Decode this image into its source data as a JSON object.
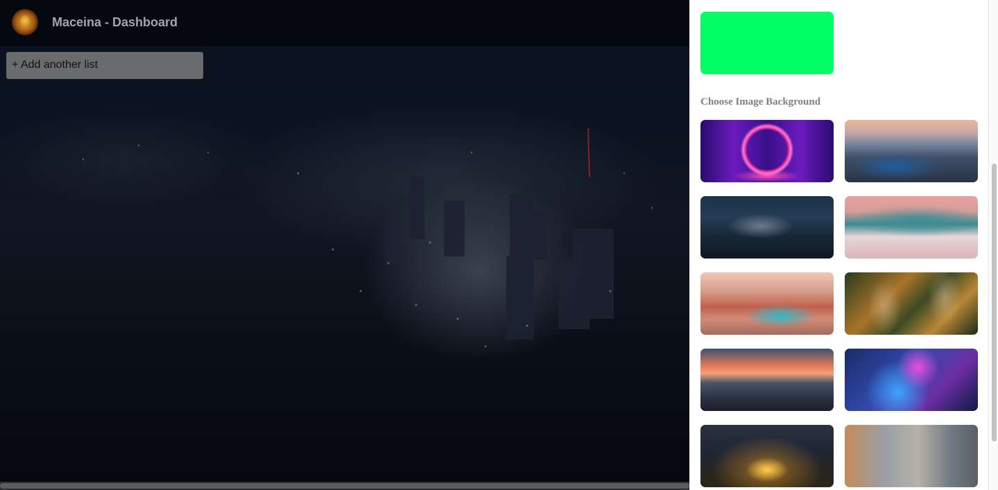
{
  "header": {
    "title": "Maceina - Dashboard",
    "logo_icon": "lion-logo-icon"
  },
  "board": {
    "add_list_label": "+ Add another list"
  },
  "background_panel": {
    "selected_color": "#00ff62",
    "image_section_title": "Choose Image Background",
    "images": [
      "neon-ring",
      "coastal-city-aerial",
      "night-city-aerial",
      "mountain-town",
      "river-city-bridge",
      "winding-forest-roads",
      "sunset-cityscape",
      "neon-city-aerial",
      "arc-de-triomphe-night",
      "tower-blocks-aerial"
    ]
  },
  "colors": {
    "panel_background": "#ffffff",
    "topbar_text": "#a3a5aa",
    "section_title": "#818181"
  }
}
